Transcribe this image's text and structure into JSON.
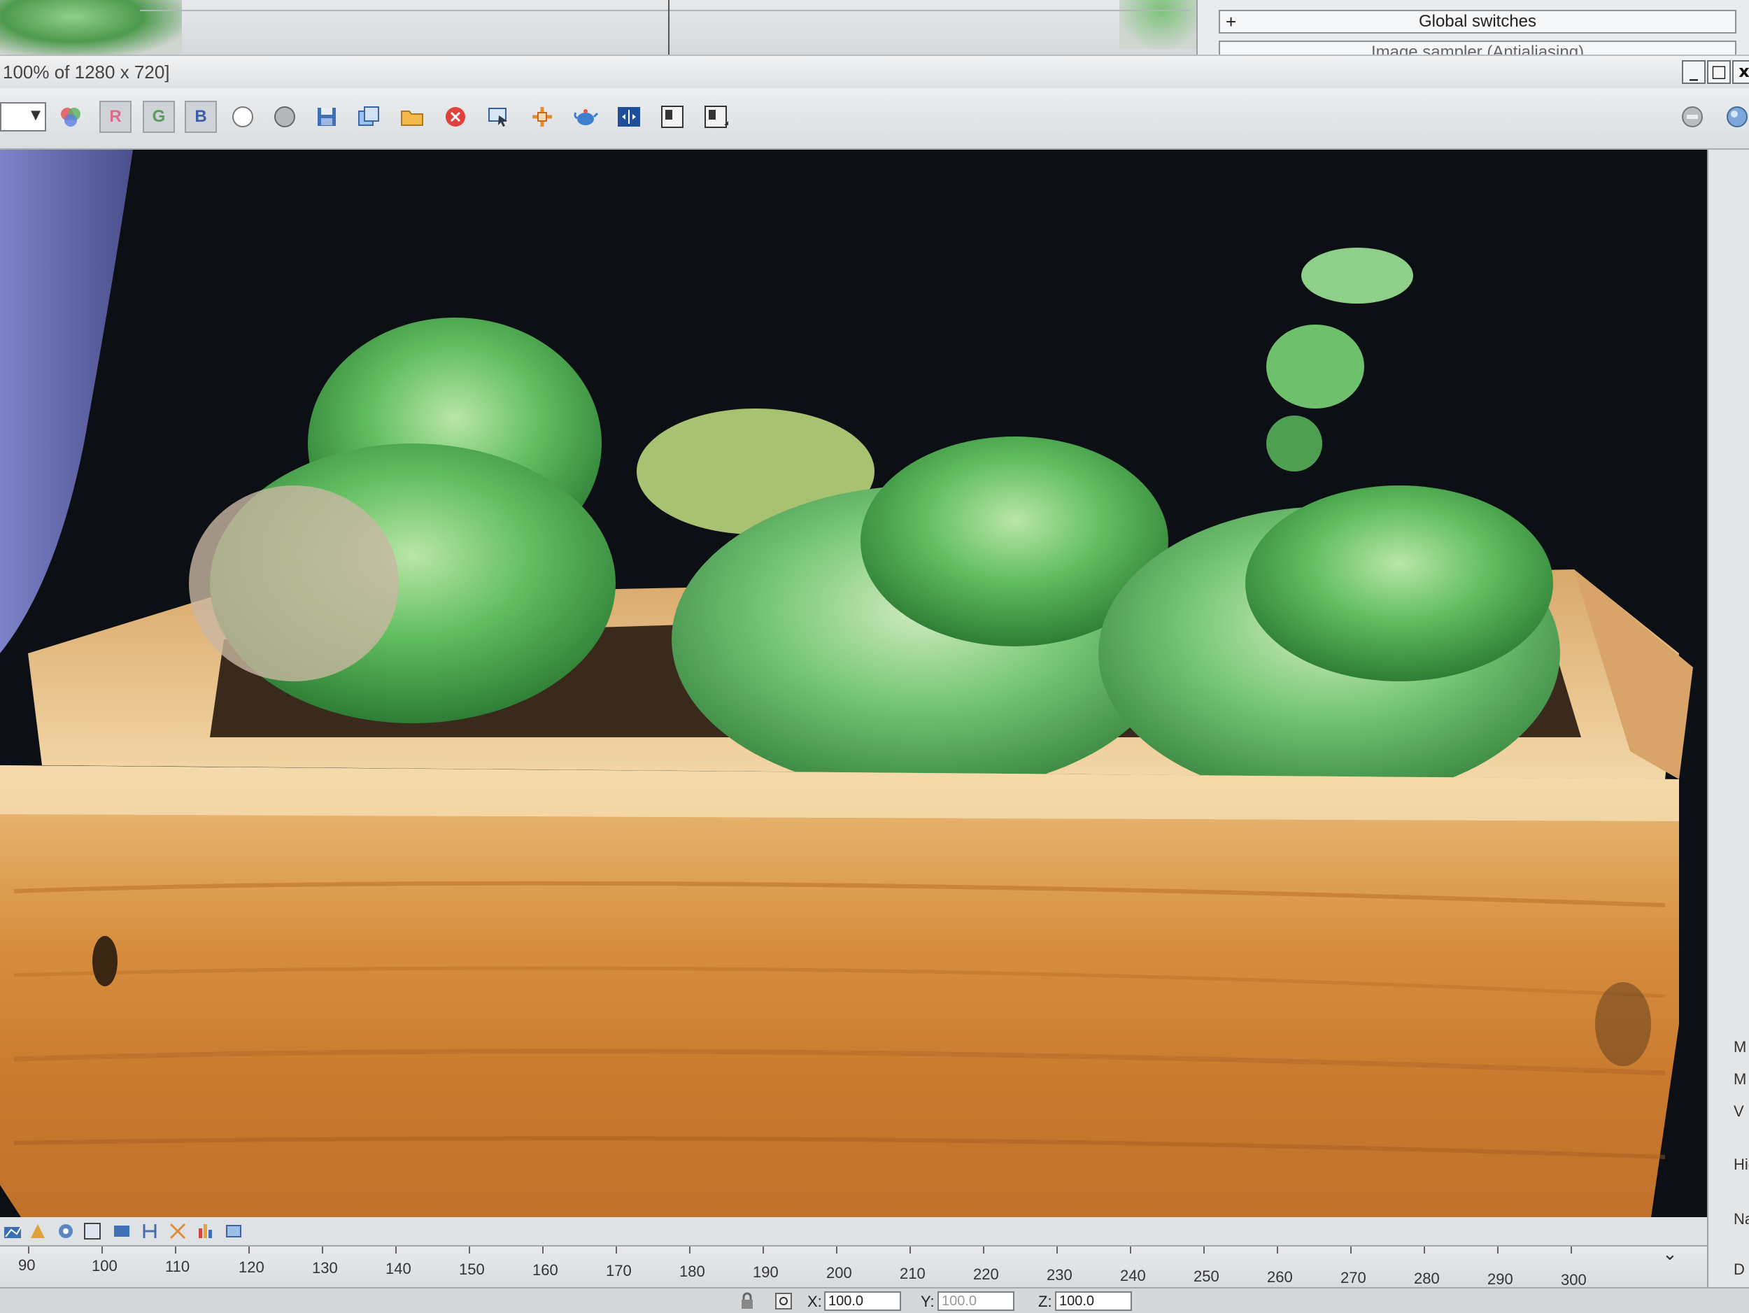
{
  "background_window": {
    "rollouts": [
      {
        "label": "Global switches",
        "prefix": "+"
      },
      {
        "label": "Image sampler (Antialiasing)",
        "prefix": ""
      }
    ]
  },
  "frame_window": {
    "title": "100% of 1280 x 720]",
    "controls": {
      "minimize": "_",
      "maximize": "□",
      "close": "x"
    },
    "toolbar": {
      "channel_select_value": "",
      "channel_buttons": {
        "red": "R",
        "green": "G",
        "blue": "B"
      },
      "icons": [
        "color-channels-icon",
        "red-channel-icon",
        "green-channel-icon",
        "blue-channel-icon",
        "white-circle-icon",
        "gray-circle-icon",
        "save-image-icon",
        "clone-frame-icon",
        "open-folder-icon",
        "clear-frame-icon",
        "track-mouse-icon",
        "region-render-icon",
        "teapot-render-icon",
        "render-region-toggle-icon",
        "compare-a-icon",
        "compare-b-icon",
        "stop-render-icon",
        "render-icon"
      ]
    },
    "render_area": {
      "image_description_colors": {
        "background": "#0c1015",
        "wood": "#cf8a3a",
        "foliage": "#5fb862"
      }
    }
  },
  "command_panel": {
    "labels": [
      "M",
      "M",
      "V",
      "Hide",
      "Nam",
      "D"
    ]
  },
  "timeline": {
    "ticks": [
      "90",
      "100",
      "110",
      "120",
      "130",
      "140",
      "150",
      "160",
      "170",
      "180",
      "190",
      "200",
      "210",
      "220",
      "230",
      "240",
      "250",
      "260",
      "270",
      "280",
      "290",
      "300"
    ],
    "expand_icon": "chevron-down-double-icon"
  },
  "status_bar": {
    "x_label": "X:",
    "x_value": "100.0",
    "y_label": "Y:",
    "y_value": "100.0",
    "z_label": "Z:",
    "z_value": "100.0"
  }
}
